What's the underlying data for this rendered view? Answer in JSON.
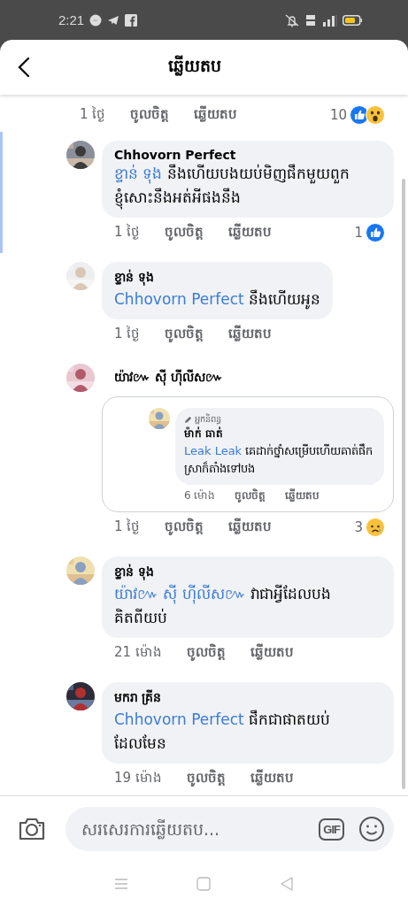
{
  "status_bar": {
    "time": "2:21"
  },
  "header": {
    "title": "ឆ្លើយតប"
  },
  "parent_meta": {
    "time": "1 ថ្ងៃ",
    "like": "ចូលចិត្ត",
    "reply": "ឆ្លើយតប",
    "reaction_count": "10",
    "reactions": [
      {
        "kind": "like"
      },
      {
        "kind": "wow"
      }
    ]
  },
  "comments": [
    {
      "kind": "bubble",
      "highlighted": true,
      "author": "Chhovorn Perfect",
      "mention": "ខ្ទាន់ ទុង",
      "text": "នឹងហើយបងយប់មិញផឹកមួយ​ពួកខ្ញុំសោះនឹងអត់អីផងនឹង",
      "time": "1 ថ្ងៃ",
      "like": "ចូលចិត្ត",
      "reply": "ឆ្លើយតប",
      "reaction_count": "1",
      "reactions": [
        {
          "kind": "like"
        }
      ]
    },
    {
      "kind": "bubble",
      "highlighted": false,
      "author": "ខ្ទាន់ ទុង",
      "mention": "Chhovorn Perfect",
      "text": "នឹងហើយអូន",
      "time": "1 ថ្ងៃ",
      "like": "ចូលចិត្ត",
      "reply": "ឆ្លើយតប"
    },
    {
      "kind": "shared",
      "highlighted": false,
      "author": "យ៉ាវ៚ ស៊ី ហ៊ីលីស៚",
      "shared_comment": {
        "badge": "អ្នកនិពន្ធ",
        "author": "ម៉ាក់ ធាត់",
        "mention": "Leak Leak",
        "text": "គេដាក់ថ្នាំសម្រើបហើយ​គាត់ផឹកស្រាក៏តាំងទៅបង",
        "time": "6 ម៉ោង",
        "like": "ចូលចិត្ត",
        "reply": "ឆ្លើយតប"
      },
      "time": "1 ថ្ងៃ",
      "like": "ចូលចិត្ត",
      "reply": "ឆ្លើយតប",
      "reaction_count": "3",
      "reactions": [
        {
          "kind": "sad"
        }
      ]
    },
    {
      "kind": "bubble",
      "highlighted": false,
      "author": "ខ្ទាន់ ទុង",
      "mention": "យ៉ាវ៚ ស៊ី ហ៊ីលីស៚",
      "text": "វាជាអ្វីដែលបង​គិតពីយប់",
      "time": "21 ម៉ោង",
      "like": "ចូលចិត្ត",
      "reply": "ឆ្លើយតប"
    },
    {
      "kind": "bubble",
      "highlighted": false,
      "author": "មករា គ្រីន",
      "mention": "Chhovorn Perfect",
      "text": "ផឹកជាផាតយប់​ដែលមែន",
      "time": "19 ម៉ោង",
      "like": "ចូលចិត្ត",
      "reply": "ឆ្លើយតប"
    }
  ],
  "composer": {
    "placeholder": "សរសេរការឆ្លើយតប...",
    "gif_label": "GIF"
  }
}
